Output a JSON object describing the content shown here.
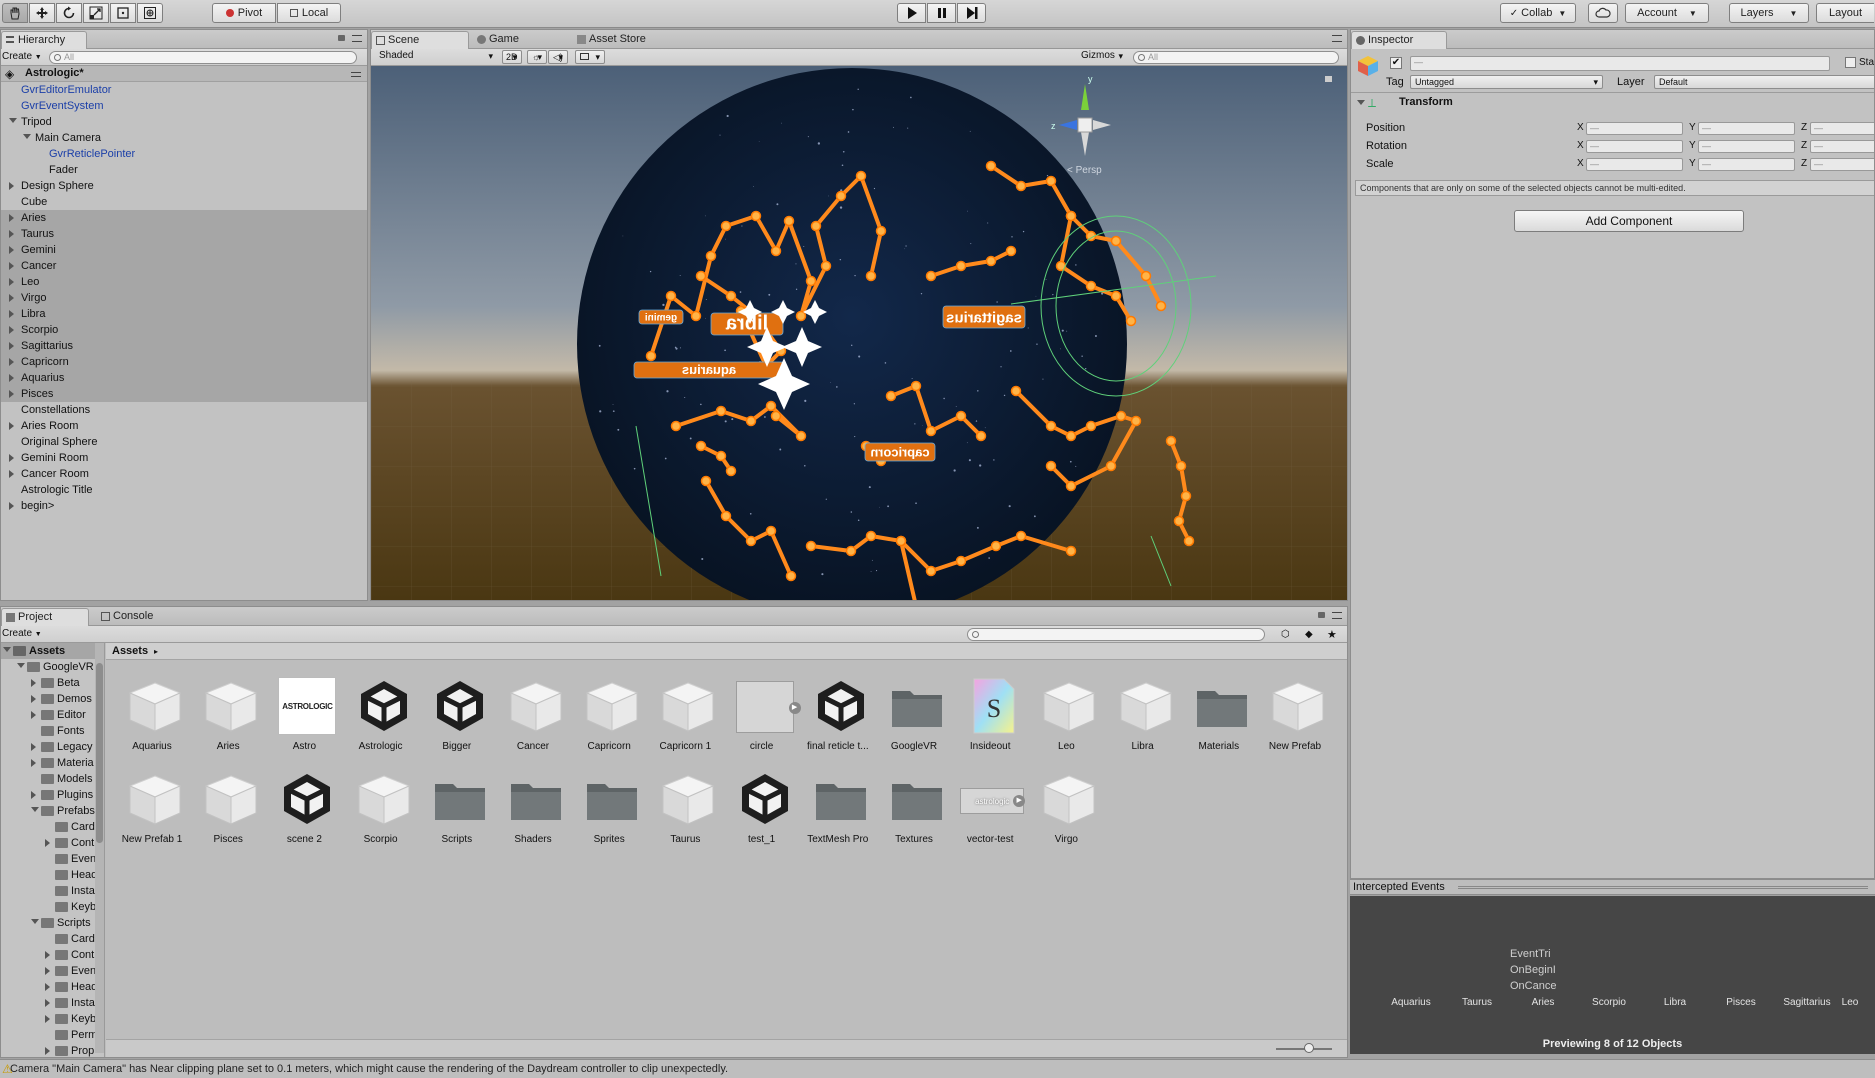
{
  "toolbar": {
    "tools": [
      "hand-icon",
      "move-icon",
      "rotate-icon",
      "scale-icon",
      "rect-icon",
      "transform-icon"
    ],
    "pivot_label": "Pivot",
    "local_label": "Local",
    "collab_label": "Collab",
    "account_label": "Account",
    "layers_label": "Layers",
    "layout_label": "Layout"
  },
  "hierarchy": {
    "tab": "Hierarchy",
    "create_label": "Create",
    "search_placeholder": "All",
    "scene_name": "Astrologic*",
    "rows": [
      {
        "label": "GvrEditorEmulator",
        "indent": 0,
        "expander": "none",
        "blue": true,
        "selected": false
      },
      {
        "label": "GvrEventSystem",
        "indent": 0,
        "expander": "none",
        "blue": true,
        "selected": false
      },
      {
        "label": "Tripod",
        "indent": 0,
        "expander": "open",
        "blue": false,
        "selected": false
      },
      {
        "label": "Main Camera",
        "indent": 1,
        "expander": "open",
        "blue": false,
        "selected": false
      },
      {
        "label": "GvrReticlePointer",
        "indent": 2,
        "expander": "none",
        "blue": true,
        "selected": false
      },
      {
        "label": "Fader",
        "indent": 2,
        "expander": "none",
        "blue": false,
        "selected": false
      },
      {
        "label": "Design Sphere",
        "indent": 0,
        "expander": "closed",
        "blue": false,
        "selected": false
      },
      {
        "label": "Cube",
        "indent": 0,
        "expander": "none",
        "blue": false,
        "selected": false
      },
      {
        "label": "Aries",
        "indent": 0,
        "expander": "closed",
        "blue": false,
        "selected": true
      },
      {
        "label": "Taurus",
        "indent": 0,
        "expander": "closed",
        "blue": false,
        "selected": true
      },
      {
        "label": "Gemini",
        "indent": 0,
        "expander": "closed",
        "blue": false,
        "selected": true
      },
      {
        "label": "Cancer",
        "indent": 0,
        "expander": "closed",
        "blue": false,
        "selected": true
      },
      {
        "label": "Leo",
        "indent": 0,
        "expander": "closed",
        "blue": false,
        "selected": true
      },
      {
        "label": "Virgo",
        "indent": 0,
        "expander": "closed",
        "blue": false,
        "selected": true
      },
      {
        "label": "Libra",
        "indent": 0,
        "expander": "closed",
        "blue": false,
        "selected": true
      },
      {
        "label": "Scorpio",
        "indent": 0,
        "expander": "closed",
        "blue": false,
        "selected": true
      },
      {
        "label": "Sagittarius",
        "indent": 0,
        "expander": "closed",
        "blue": false,
        "selected": true
      },
      {
        "label": "Capricorn",
        "indent": 0,
        "expander": "closed",
        "blue": false,
        "selected": true
      },
      {
        "label": "Aquarius",
        "indent": 0,
        "expander": "closed",
        "blue": false,
        "selected": true
      },
      {
        "label": "Pisces",
        "indent": 0,
        "expander": "closed",
        "blue": false,
        "selected": true
      },
      {
        "label": "Constellations",
        "indent": 0,
        "expander": "none",
        "blue": false,
        "selected": false
      },
      {
        "label": "Aries Room",
        "indent": 0,
        "expander": "closed",
        "blue": false,
        "selected": false
      },
      {
        "label": "Original Sphere",
        "indent": 0,
        "expander": "none",
        "blue": false,
        "selected": false
      },
      {
        "label": "Gemini Room",
        "indent": 0,
        "expander": "closed",
        "blue": false,
        "selected": false
      },
      {
        "label": "Cancer Room",
        "indent": 0,
        "expander": "closed",
        "blue": false,
        "selected": false
      },
      {
        "label": "Astrologic Title",
        "indent": 0,
        "expander": "none",
        "blue": false,
        "selected": false
      },
      {
        "label": "begin>",
        "indent": 0,
        "expander": "closed",
        "blue": false,
        "selected": false
      }
    ]
  },
  "scene": {
    "tabs": [
      "Scene",
      "Game",
      "Asset Store"
    ],
    "shading": "Shaded",
    "mode_2d": "2D",
    "gizmos_label": "Gizmos",
    "search_placeholder": "All",
    "persp_label": "< Persp",
    "axis_y": "y",
    "axis_z": "z",
    "sphere_labels": [
      "libra",
      "gemini",
      "sagittarius",
      "capricorn",
      "aquarius"
    ]
  },
  "inspector": {
    "tab": "Inspector",
    "static_label": "Sta",
    "name_value": "—",
    "tag_label": "Tag",
    "tag_value": "Untagged",
    "layer_label": "Layer",
    "layer_value": "Default",
    "transform_title": "Transform",
    "rows": [
      "Position",
      "Rotation",
      "Scale"
    ],
    "axes": [
      "X",
      "Y",
      "Z"
    ],
    "dash": "—",
    "multi_edit_note": "Components that are only on some of the selected objects cannot be multi-edited.",
    "add_component_label": "Add Component"
  },
  "preview": {
    "title": "Intercepted Events",
    "events": [
      "EventTri",
      "OnBeginI",
      "OnCance"
    ],
    "names": [
      "Aquarius",
      "Taurus",
      "Aries",
      "Scorpio",
      "Libra",
      "Pisces",
      "Sagittarius",
      "Leo"
    ],
    "footer": "Previewing 8 of 12 Objects"
  },
  "project": {
    "tabs": [
      "Project",
      "Console"
    ],
    "create_label": "Create",
    "breadcrumb": "Assets",
    "tree": [
      {
        "label": "Assets",
        "indent": 0,
        "expander": "open",
        "selected": true
      },
      {
        "label": "GoogleVR",
        "indent": 1,
        "expander": "open",
        "selected": false
      },
      {
        "label": "Beta",
        "indent": 2,
        "expander": "closed",
        "selected": false
      },
      {
        "label": "Demos",
        "indent": 2,
        "expander": "closed",
        "selected": false
      },
      {
        "label": "Editor",
        "indent": 2,
        "expander": "closed",
        "selected": false
      },
      {
        "label": "Fonts",
        "indent": 2,
        "expander": "none",
        "selected": false
      },
      {
        "label": "Legacy",
        "indent": 2,
        "expander": "closed",
        "selected": false
      },
      {
        "label": "Materia",
        "indent": 2,
        "expander": "closed",
        "selected": false
      },
      {
        "label": "Models",
        "indent": 2,
        "expander": "none",
        "selected": false
      },
      {
        "label": "Plugins",
        "indent": 2,
        "expander": "closed",
        "selected": false
      },
      {
        "label": "Prefabs",
        "indent": 2,
        "expander": "open",
        "selected": false
      },
      {
        "label": "Card",
        "indent": 3,
        "expander": "none",
        "selected": false
      },
      {
        "label": "Cont",
        "indent": 3,
        "expander": "closed",
        "selected": false
      },
      {
        "label": "Even",
        "indent": 3,
        "expander": "none",
        "selected": false
      },
      {
        "label": "Head",
        "indent": 3,
        "expander": "none",
        "selected": false
      },
      {
        "label": "Insta",
        "indent": 3,
        "expander": "none",
        "selected": false
      },
      {
        "label": "Keyb",
        "indent": 3,
        "expander": "none",
        "selected": false
      },
      {
        "label": "Scripts",
        "indent": 2,
        "expander": "open",
        "selected": false
      },
      {
        "label": "Card",
        "indent": 3,
        "expander": "none",
        "selected": false
      },
      {
        "label": "Cont",
        "indent": 3,
        "expander": "closed",
        "selected": false
      },
      {
        "label": "Even",
        "indent": 3,
        "expander": "closed",
        "selected": false
      },
      {
        "label": "Head",
        "indent": 3,
        "expander": "closed",
        "selected": false
      },
      {
        "label": "Insta",
        "indent": 3,
        "expander": "closed",
        "selected": false
      },
      {
        "label": "Keyb",
        "indent": 3,
        "expander": "closed",
        "selected": false
      },
      {
        "label": "Perm",
        "indent": 3,
        "expander": "none",
        "selected": false
      },
      {
        "label": "Prop",
        "indent": 3,
        "expander": "closed",
        "selected": false
      }
    ],
    "assets": [
      {
        "label": "Aquarius",
        "kind": "prefab"
      },
      {
        "label": "Aries",
        "kind": "prefab"
      },
      {
        "label": "Astro",
        "kind": "texture-astrologic",
        "thumb_text": "ASTROLOGIC"
      },
      {
        "label": "Astrologic",
        "kind": "unity"
      },
      {
        "label": "Bigger",
        "kind": "unity"
      },
      {
        "label": "Cancer",
        "kind": "prefab"
      },
      {
        "label": "Capricorn",
        "kind": "prefab"
      },
      {
        "label": "Capricorn 1",
        "kind": "prefab"
      },
      {
        "label": "circle",
        "kind": "sprite-blank"
      },
      {
        "label": "final reticle t...",
        "kind": "unity"
      },
      {
        "label": "GoogleVR",
        "kind": "folder"
      },
      {
        "label": "Insideout",
        "kind": "shader"
      },
      {
        "label": "Leo",
        "kind": "prefab"
      },
      {
        "label": "Libra",
        "kind": "prefab"
      },
      {
        "label": "Materials",
        "kind": "folder"
      },
      {
        "label": "New Prefab",
        "kind": "prefab"
      },
      {
        "label": "New Prefab 1",
        "kind": "prefab"
      },
      {
        "label": "Pisces",
        "kind": "prefab"
      },
      {
        "label": "scene 2",
        "kind": "unity"
      },
      {
        "label": "Scorpio",
        "kind": "prefab"
      },
      {
        "label": "Scripts",
        "kind": "folder"
      },
      {
        "label": "Shaders",
        "kind": "folder"
      },
      {
        "label": "Sprites",
        "kind": "folder"
      },
      {
        "label": "Taurus",
        "kind": "prefab"
      },
      {
        "label": "test_1",
        "kind": "unity"
      },
      {
        "label": "TextMesh Pro",
        "kind": "folder"
      },
      {
        "label": "Textures",
        "kind": "folder"
      },
      {
        "label": "vector-test",
        "kind": "sprite-astrologic",
        "thumb_text": "astrologic"
      },
      {
        "label": "Virgo",
        "kind": "prefab"
      }
    ]
  },
  "status_bar": {
    "message": "Camera \"Main Camera\" has Near clipping plane set to 0.1 meters, which might cause the rendering of the Daydream controller to clip unexpectedly."
  },
  "colors": {
    "constellation": "#ff8a1c",
    "sphere": "#0b1a33",
    "selection": "#a6a6a6",
    "prefab_text": "#1b3fa8"
  }
}
